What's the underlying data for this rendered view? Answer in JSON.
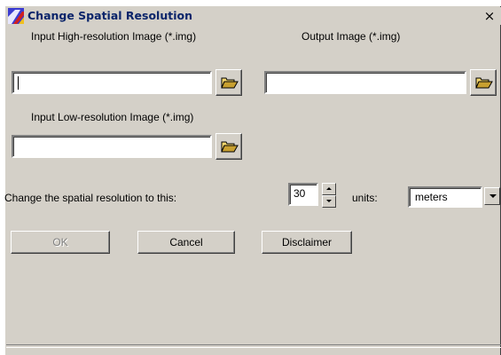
{
  "window": {
    "title": "Change Spatial Resolution",
    "close_symbol": "×",
    "app_icon": "erdas-imagine-icon"
  },
  "inputs": {
    "high_res_label": "Input High-resolution Image (*.img)",
    "high_res_value": "",
    "low_res_label": "Input Low-resolution Image (*.img)",
    "low_res_value": "",
    "output_label": "Output Image (*.img)",
    "output_value": "",
    "browse_icon": "folder-open-icon"
  },
  "resolution": {
    "label": "Change the spatial resolution to this:",
    "value": "30",
    "units_label": "units:",
    "units_value": "meters"
  },
  "buttons": {
    "ok": "OK",
    "cancel": "Cancel",
    "disclaimer": "Disclaimer"
  },
  "colors": {
    "title_text": "#0a246a",
    "dialog_face": "#d4d0c8"
  }
}
